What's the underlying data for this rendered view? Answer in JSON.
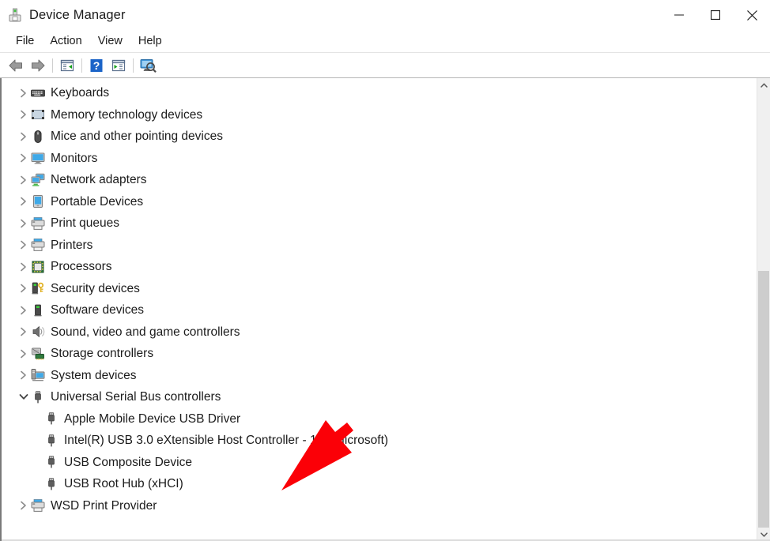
{
  "window": {
    "title": "Device Manager",
    "icon": "device-manager-icon",
    "controls": [
      {
        "name": "minimize-button",
        "glyph": "minimize-icon",
        "label": "Minimize"
      },
      {
        "name": "maximize-button",
        "glyph": "maximize-icon",
        "label": "Maximize"
      },
      {
        "name": "close-button",
        "glyph": "close-icon",
        "label": "Close"
      }
    ]
  },
  "menubar": {
    "items": [
      {
        "label": "File"
      },
      {
        "label": "Action"
      },
      {
        "label": "View"
      },
      {
        "label": "Help"
      }
    ]
  },
  "toolbar": {
    "buttons": [
      {
        "name": "back-button",
        "icon": "back-arrow-icon"
      },
      {
        "name": "forward-button",
        "icon": "forward-arrow-icon"
      },
      {
        "name": "show-hide-console-tree-button",
        "icon": "console-tree-icon"
      },
      {
        "name": "help-button",
        "icon": "question-mark-icon"
      },
      {
        "name": "properties-button",
        "icon": "properties-icon"
      },
      {
        "name": "scan-for-hardware-changes-button",
        "icon": "scan-hardware-icon"
      }
    ]
  },
  "tree": {
    "nodes": [
      {
        "label": "Keyboards",
        "level": 1,
        "state": "collapsed",
        "icon": "keyboard-icon"
      },
      {
        "label": "Memory technology devices",
        "level": 1,
        "state": "collapsed",
        "icon": "memory-icon"
      },
      {
        "label": "Mice and other pointing devices",
        "level": 1,
        "state": "collapsed",
        "icon": "mouse-icon"
      },
      {
        "label": "Monitors",
        "level": 1,
        "state": "collapsed",
        "icon": "monitor-icon"
      },
      {
        "label": "Network adapters",
        "level": 1,
        "state": "collapsed",
        "icon": "network-adapter-icon"
      },
      {
        "label": "Portable Devices",
        "level": 1,
        "state": "collapsed",
        "icon": "portable-device-icon"
      },
      {
        "label": "Print queues",
        "level": 1,
        "state": "collapsed",
        "icon": "printer-icon"
      },
      {
        "label": "Printers",
        "level": 1,
        "state": "collapsed",
        "icon": "printer-icon"
      },
      {
        "label": "Processors",
        "level": 1,
        "state": "collapsed",
        "icon": "processor-icon"
      },
      {
        "label": "Security devices",
        "level": 1,
        "state": "collapsed",
        "icon": "security-device-icon"
      },
      {
        "label": "Software devices",
        "level": 1,
        "state": "collapsed",
        "icon": "software-device-icon"
      },
      {
        "label": "Sound, video and game controllers",
        "level": 1,
        "state": "collapsed",
        "icon": "speaker-icon"
      },
      {
        "label": "Storage controllers",
        "level": 1,
        "state": "collapsed",
        "icon": "storage-controller-icon"
      },
      {
        "label": "System devices",
        "level": 1,
        "state": "collapsed",
        "icon": "system-device-icon"
      },
      {
        "label": "Universal Serial Bus controllers",
        "level": 1,
        "state": "expanded",
        "icon": "usb-icon"
      },
      {
        "label": "Apple Mobile Device USB Driver",
        "level": 2,
        "state": "leaf",
        "icon": "usb-icon"
      },
      {
        "label": "Intel(R) USB 3.0 eXtensible Host Controller - 1.0 (Microsoft)",
        "level": 2,
        "state": "leaf",
        "icon": "usb-icon"
      },
      {
        "label": "USB Composite Device",
        "level": 2,
        "state": "leaf",
        "icon": "usb-icon"
      },
      {
        "label": "USB Root Hub (xHCI)",
        "level": 2,
        "state": "leaf",
        "icon": "usb-icon"
      },
      {
        "label": "WSD Print Provider",
        "level": 1,
        "state": "collapsed",
        "icon": "printer-icon"
      }
    ]
  },
  "scrollbar": {
    "up_arrow": "scroll-up-icon",
    "down_arrow": "scroll-down-icon"
  },
  "annotation": {
    "name": "red-arrow-pointer",
    "color": "#fb0007",
    "points_at": "Apple Mobile Device USB Driver"
  },
  "colors": {
    "window_background": "#ffffff",
    "text": "#1b1b1b",
    "twisty": "#8c8c8c",
    "scrollbar_track": "#f0f0f0",
    "scrollbar_thumb": "#cdcdcd",
    "accent_red": "#fb0007"
  }
}
